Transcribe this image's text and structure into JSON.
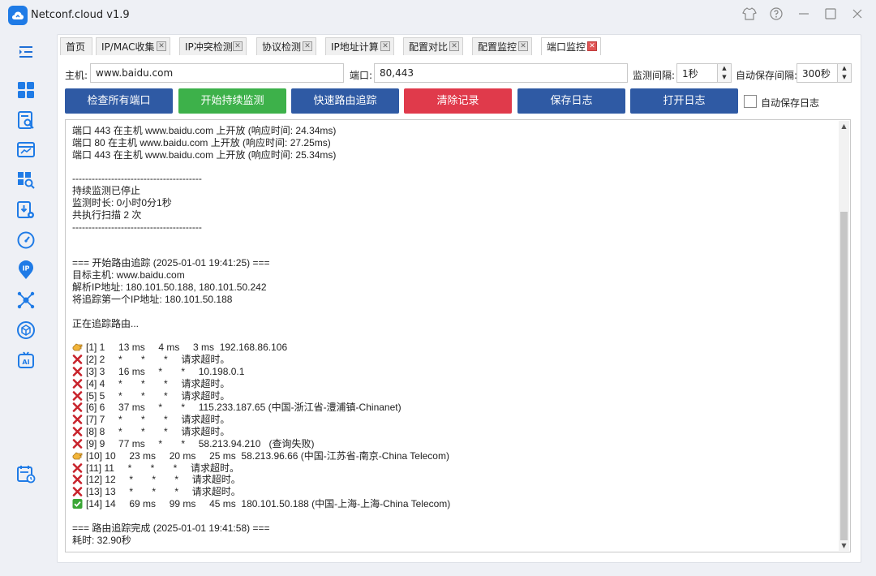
{
  "app": {
    "title": "Netconf.cloud v1.9"
  },
  "tabs": [
    {
      "label": "首页",
      "closable": false
    },
    {
      "label": "IP/MAC收集",
      "closable": true
    },
    {
      "label": "IP冲突检测",
      "closable": true
    },
    {
      "label": "协议检测",
      "closable": true
    },
    {
      "label": "IP地址计算",
      "closable": true
    },
    {
      "label": "配置对比",
      "closable": true
    },
    {
      "label": "配置监控",
      "closable": true
    },
    {
      "label": "端口监控",
      "closable": true,
      "active": true
    }
  ],
  "form": {
    "host_label": "主机:",
    "host_value": "www.baidu.com",
    "port_label": "端口:",
    "port_value": "80,443",
    "interval_label": "监测间隔:",
    "interval_value": "1秒",
    "autosave_interval_label": "自动保存间隔:",
    "autosave_interval_value": "300秒"
  },
  "buttons": {
    "check_all": "检查所有端口",
    "start_monitor": "开始持续监测",
    "quick_trace": "快速路由追踪",
    "clear_log": "清除记录",
    "save_log": "保存日志",
    "open_log": "打开日志",
    "autosave_checkbox": "自动保存日志"
  },
  "colors": {
    "accent_blue": "#2f5aa4",
    "green": "#3db14a",
    "red": "#e03a4b"
  },
  "log": {
    "lines": [
      {
        "text": "端口 443 在主机 www.baidu.com 上开放 (响应时间: 24.34ms)"
      },
      {
        "text": "端口 80 在主机 www.baidu.com 上开放 (响应时间: 27.25ms)"
      },
      {
        "text": "端口 443 在主机 www.baidu.com 上开放 (响应时间: 25.34ms)"
      },
      {
        "text": ""
      },
      {
        "text": "----------------------------------------"
      },
      {
        "text": "持续监测已停止"
      },
      {
        "text": "监测时长: 0小时0分1秒"
      },
      {
        "text": "共执行扫描 2 次"
      },
      {
        "text": "----------------------------------------"
      },
      {
        "text": ""
      },
      {
        "text": ""
      },
      {
        "text": "=== 开始路由追踪 (2025-01-01 19:41:25) ==="
      },
      {
        "text": "目标主机: www.baidu.com"
      },
      {
        "text": "解析IP地址: 180.101.50.188, 180.101.50.242"
      },
      {
        "text": "将追踪第一个IP地址: 180.101.50.188"
      },
      {
        "text": ""
      },
      {
        "text": "正在追踪路由..."
      },
      {
        "text": ""
      },
      {
        "mark": "hand-point-icon",
        "text": "[1] 1     13 ms     4 ms     3 ms  192.168.86.106"
      },
      {
        "mark": "cross-icon",
        "text": "[2] 2     *       *       *     请求超时。"
      },
      {
        "mark": "cross-icon",
        "text": "[3] 3     16 ms     *       *     10.198.0.1"
      },
      {
        "mark": "cross-icon",
        "text": "[4] 4     *       *       *     请求超时。"
      },
      {
        "mark": "cross-icon",
        "text": "[5] 5     *       *       *     请求超时。"
      },
      {
        "mark": "cross-icon",
        "text": "[6] 6     37 ms     *       *     115.233.187.65 (中国-浙江省-澧浦镇-Chinanet)"
      },
      {
        "mark": "cross-icon",
        "text": "[7] 7     *       *       *     请求超时。"
      },
      {
        "mark": "cross-icon",
        "text": "[8] 8     *       *       *     请求超时。"
      },
      {
        "mark": "cross-icon",
        "text": "[9] 9     77 ms     *       *     58.213.94.210   (查询失败)"
      },
      {
        "mark": "hand-point-icon",
        "text": "[10] 10     23 ms     20 ms     25 ms  58.213.96.66 (中国-江苏省-南京-China Telecom)"
      },
      {
        "mark": "cross-icon",
        "text": "[11] 11     *       *       *     请求超时。"
      },
      {
        "mark": "cross-icon",
        "text": "[12] 12     *       *       *     请求超时。"
      },
      {
        "mark": "cross-icon",
        "text": "[13] 13     *       *       *     请求超时。"
      },
      {
        "mark": "check-icon",
        "text": "[14] 14     69 ms     99 ms     45 ms  180.101.50.188 (中国-上海-上海-China Telecom)"
      },
      {
        "text": ""
      },
      {
        "text": "=== 路由追踪完成 (2025-01-01 19:41:58) ==="
      },
      {
        "text": "耗时: 32.90秒"
      }
    ]
  }
}
